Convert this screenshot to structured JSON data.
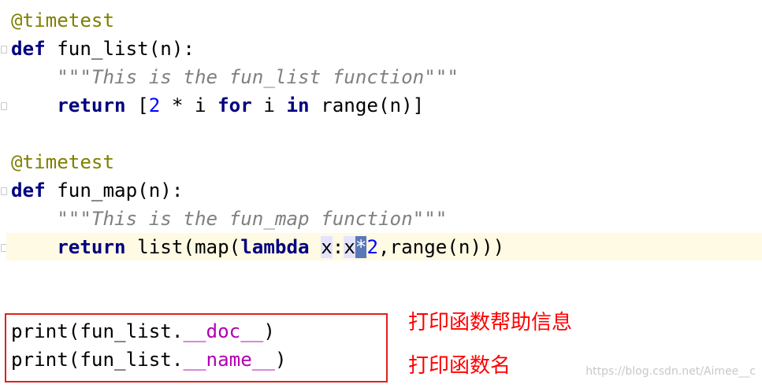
{
  "code": {
    "block1": {
      "decorator": "@timetest",
      "def_kw": "def",
      "def_rest": " fun_list(n):",
      "indent": "    ",
      "docstring": "\"\"\"This is the fun_list function\"\"\"",
      "return_kw": "return",
      "ret_a": " [",
      "num2": "2",
      "ret_b": " * i ",
      "for_kw": "for",
      "ret_c": " i ",
      "in_kw": "in",
      "ret_d": " range(n)]"
    },
    "block2": {
      "decorator": "@timetest",
      "def_kw": "def",
      "def_rest": " fun_map(n):",
      "indent": "    ",
      "docstring": "\"\"\"This is the fun_map function\"\"\"",
      "return_kw": "return",
      "ret_a": " list(map(",
      "lambda_kw": "lambda",
      "space": " ",
      "param_x": "x",
      "colon": ":",
      "x2": "x",
      "star": "*",
      "num2": "2",
      "ret_b": ",range(n)))"
    },
    "print1": {
      "prefix": "print(fun_list.",
      "dunder": "__doc__",
      "suffix": ")"
    },
    "print2": {
      "prefix": "print(fun_list.",
      "dunder": "__name__",
      "suffix": ")"
    }
  },
  "annotations": {
    "note1": "打印函数帮助信息",
    "note2": "打印函数名"
  },
  "watermark": "https://blog.csdn.net/Aimee__c",
  "colors": {
    "decorator": "#808000",
    "keyword": "#000080",
    "docstring": "#808080",
    "number": "#0000ff",
    "magic": "#b200b2",
    "annotation": "#ff0000",
    "current_line": "#fffae3"
  }
}
